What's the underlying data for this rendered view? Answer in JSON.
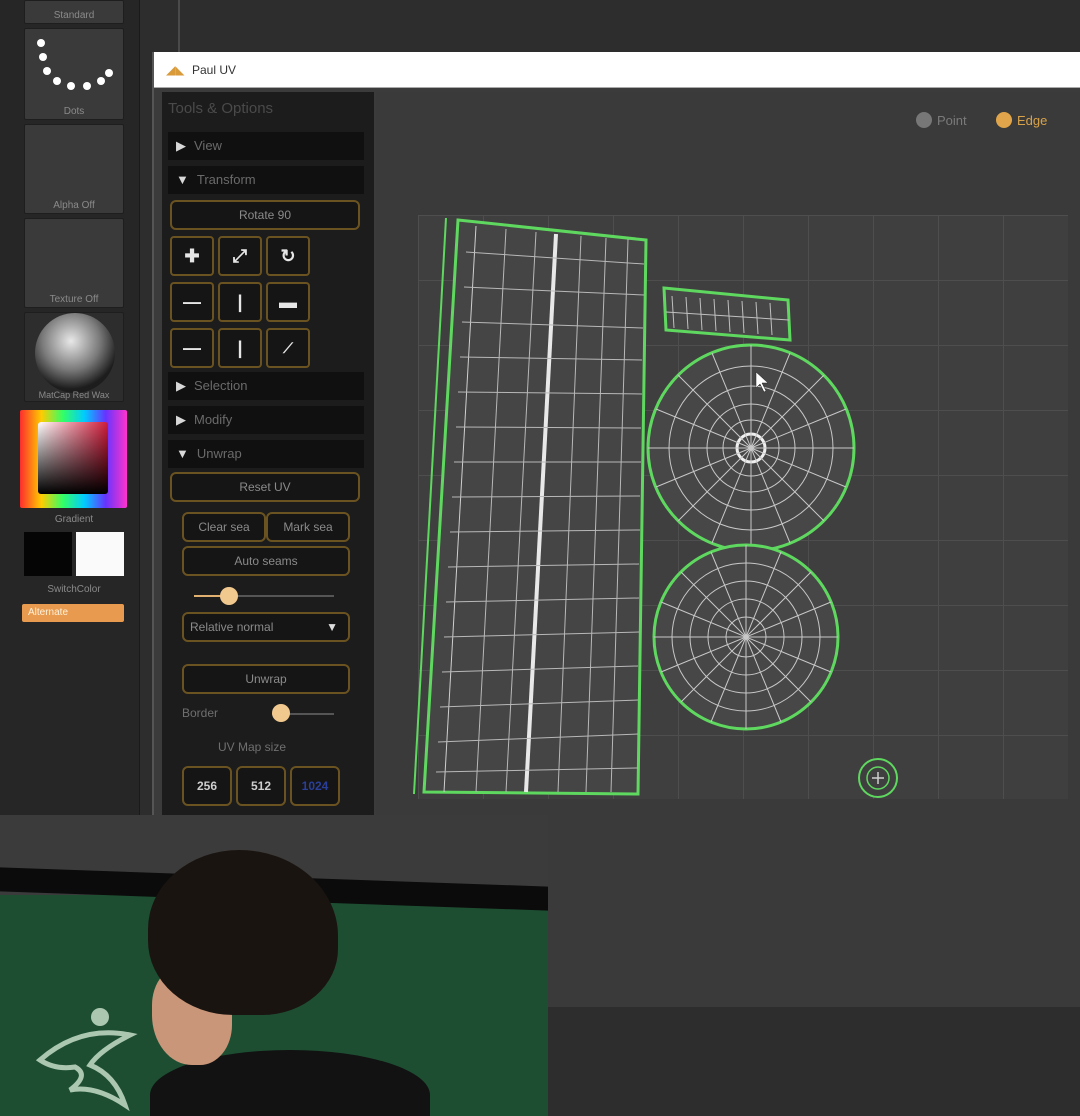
{
  "app": {
    "window_title": "Paul UV",
    "accent_color": "#e0a54a",
    "uv_line_color": "#5fd85f"
  },
  "shelf": {
    "labels": [
      "Standard",
      "Dots",
      "Alpha Off",
      "Texture Off",
      "MatCap Red Wax",
      "Gradient",
      "SwitchColor",
      "Alternate"
    ]
  },
  "tools": {
    "header": "Tools & Options",
    "sections": {
      "view": "View",
      "transform": "Transform",
      "selection": "Selection",
      "modify": "Modify",
      "unwrap": "Unwrap"
    },
    "rotate_button": "Rotate 90",
    "reset_uv_button": "Reset UV",
    "clear_seams_button": "Clear sea",
    "mark_seams_button": "Mark sea",
    "auto_seams_button": "Auto seams",
    "relative_dropdown": "Relative normal",
    "unwrap_button": "Unwrap",
    "border_label": "Border",
    "uv_map_size_label": "UV Map size",
    "map_sizes": [
      "256",
      "512",
      "1024"
    ],
    "auto_seams_slider_value": 0.3,
    "border_slider_value": 0.1
  },
  "viewport": {
    "point_label": "Point",
    "edge_label": "Edge"
  }
}
